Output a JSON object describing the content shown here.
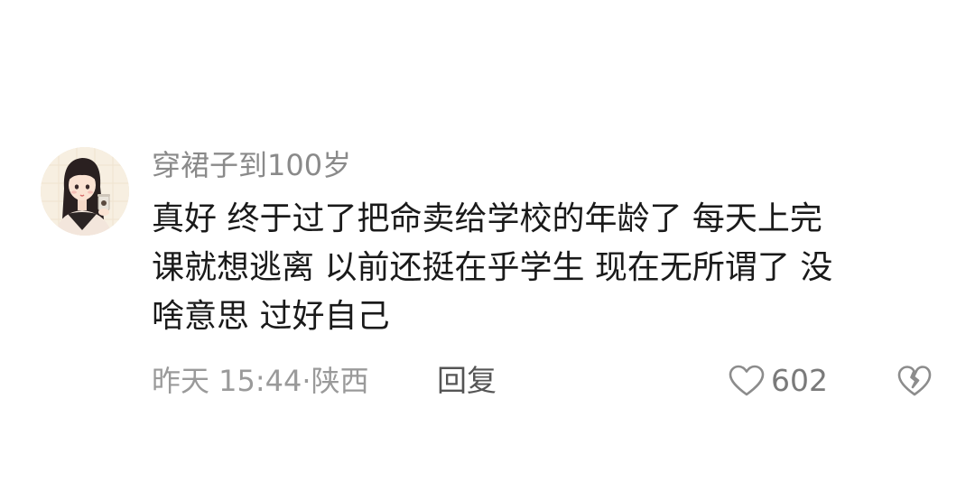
{
  "comment": {
    "avatar_icon": "user-avatar-girl",
    "username": "穿裙子到100岁",
    "content_lines": [
      "真好 终于过了把命卖给学校的年龄了 每天上完",
      "课就想逃离 以前还挺在乎学生 现在无所谓了 没",
      "啥意思 过好自己"
    ],
    "time": "昨天 15:44",
    "separator": "·",
    "location": "陕西",
    "reply_label": "回复",
    "like_icon": "heart-outline-icon",
    "like_count": "602",
    "dislike_icon": "broken-heart-icon"
  }
}
